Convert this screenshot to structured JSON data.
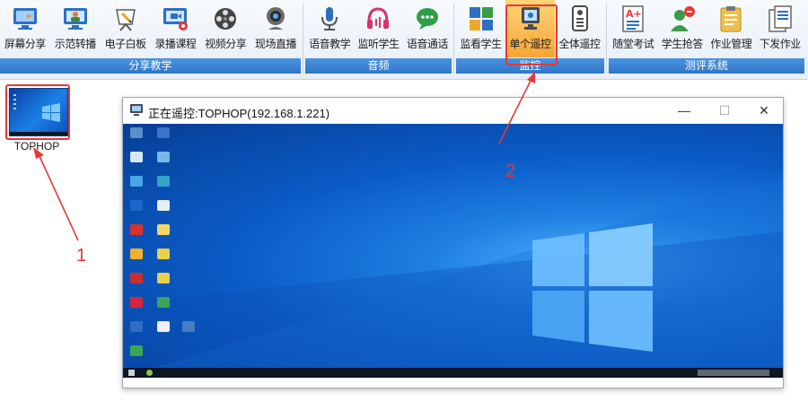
{
  "toolbar": {
    "groups": [
      {
        "label": "分享教学",
        "buttons": [
          {
            "label": "屏幕分享",
            "icon": "screen-share-icon"
          },
          {
            "label": "示范转播",
            "icon": "demo-broadcast-icon"
          },
          {
            "label": "电子白板",
            "icon": "whiteboard-icon"
          },
          {
            "label": "录播课程",
            "icon": "record-course-icon"
          },
          {
            "label": "视频分享",
            "icon": "video-share-icon"
          },
          {
            "label": "现场直播",
            "icon": "live-camera-icon"
          }
        ]
      },
      {
        "label": "音频",
        "buttons": [
          {
            "label": "语音教学",
            "icon": "microphone-icon"
          },
          {
            "label": "监听学生",
            "icon": "headphones-icon"
          },
          {
            "label": "语音通话",
            "icon": "chat-bubble-icon"
          }
        ]
      },
      {
        "label": "监控",
        "buttons": [
          {
            "label": "监看学生",
            "icon": "monitor-grid-icon"
          },
          {
            "label": "单个遥控",
            "icon": "single-remote-icon",
            "active": true
          },
          {
            "label": "全体遥控",
            "icon": "all-remote-icon"
          }
        ]
      },
      {
        "label": "测评系统",
        "buttons": [
          {
            "label": "随堂考试",
            "icon": "exam-icon"
          },
          {
            "label": "学生抢答",
            "icon": "buzzer-icon"
          },
          {
            "label": "作业管理",
            "icon": "clipboard-icon"
          },
          {
            "label": "下发作业",
            "icon": "distribute-doc-icon"
          }
        ]
      }
    ]
  },
  "student": {
    "name": "TOPHOP"
  },
  "remote_window": {
    "title": "正在遥控:TOPHOP(192.168.1.221)",
    "minimize": "—",
    "maximize": "☐",
    "close": "✕"
  },
  "annotations": {
    "step1": "1",
    "step2": "2"
  },
  "colors": {
    "accent": "#2f76c8",
    "highlight": "#f7a534",
    "annotation": "#e53935"
  }
}
